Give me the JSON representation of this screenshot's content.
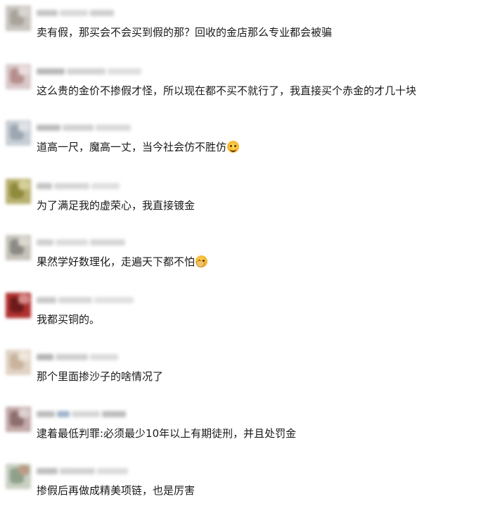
{
  "comments": [
    {
      "text": "卖有假，那买会不会买到假的那？回收的金店那么专业都会被骗",
      "emoji": null,
      "avatar_colors": [
        "#c8c4bf",
        "#a9a39c",
        "#d8d4cf"
      ],
      "name_colors": [
        "#c6c6c6",
        "#d9d9d9",
        "#cfcfcf"
      ]
    },
    {
      "text": "这么贵的金价不掺假才怪，所以现在都不买不就行了，我直接买个赤金的才几十块",
      "emoji": null,
      "avatar_colors": [
        "#d9c9c9",
        "#b78f8f",
        "#eadddd"
      ],
      "name_colors": [
        "#b9b9b9",
        "#d3d3d3",
        "#dedede"
      ]
    },
    {
      "text": "道高一尺，魔高一丈，当今社会仿不胜仿",
      "emoji": "grimace-emoji",
      "avatar_colors": [
        "#c7cdd4",
        "#9ea7b2",
        "#dfe3e8"
      ],
      "name_colors": [
        "#bdbdbd",
        "#d2d2d2",
        "#dadada"
      ]
    },
    {
      "text": "为了满足我的虚荣心，我直接镀金",
      "emoji": null,
      "avatar_colors": [
        "#b8b070",
        "#8f8a3c",
        "#d5cf98"
      ],
      "name_colors": [
        "#c4c4c4",
        "#d6d6d6",
        "#e0e0e0"
      ]
    },
    {
      "text": "果然学好数理化，走遍天下都不怕",
      "emoji": "facepalm-emoji",
      "avatar_colors": [
        "#c6c3bb",
        "#8b8b84",
        "#dcd8cf"
      ],
      "name_colors": [
        "#d0d0d0",
        "#dcdcdc",
        "#d6d6d6"
      ]
    },
    {
      "text": "我都买铜的。",
      "emoji": null,
      "avatar_colors": [
        "#b03030",
        "#6e1a1a",
        "#d88a8a"
      ],
      "name_colors": [
        "#c9c9c9",
        "#d8d8d8",
        "#e1e1e1"
      ]
    },
    {
      "text": "那个里面掺沙子的啥情况了",
      "emoji": null,
      "avatar_colors": [
        "#e0d2c4",
        "#c9b49e",
        "#efe6dc"
      ],
      "name_colors": [
        "#b5b5b5",
        "#cfcfcf",
        "#dcdcdc"
      ]
    },
    {
      "text": "逮着最低判罪:必须最少10年以上有期徒刑，并且处罚金",
      "emoji": null,
      "avatar_colors": [
        "#c3a9a9",
        "#8e6e6e",
        "#ddd0d0"
      ],
      "name_colors": [
        "#bdbdbd",
        "#9fb4cc",
        "#d6d6d6"
      ]
    },
    {
      "text": "掺假后再做成精美项链，也是厉害",
      "emoji": null,
      "avatar_colors": [
        "#c8d0c2",
        "#8fa08a",
        "#b99c86"
      ],
      "name_colors": [
        "#bfbfbf",
        "#d2d2d2",
        "#dcdcdc"
      ]
    }
  ]
}
